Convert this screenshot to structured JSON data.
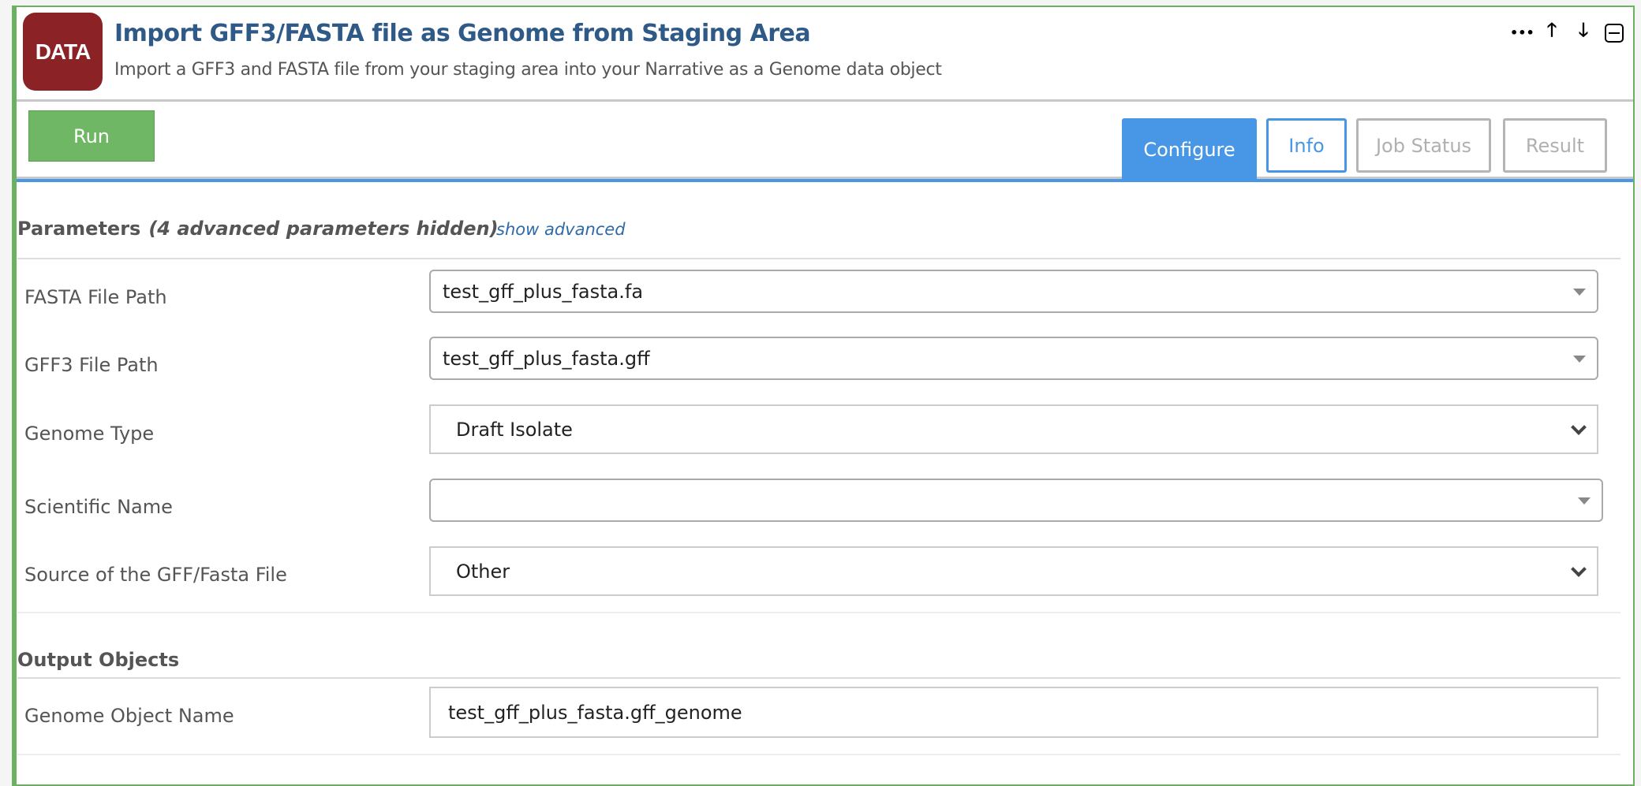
{
  "header": {
    "logo_text": "DATA",
    "title": "Import GFF3/FASTA file as Genome from Staging Area",
    "subtitle": "Import a GFF3 and FASTA file from your staging area into your Narrative as a Genome data object",
    "icons": [
      "more-icon",
      "arrow-up-icon",
      "arrow-down-icon",
      "collapse-icon"
    ],
    "more_glyph": "•••",
    "up_glyph": "🡑",
    "down_glyph": "🡓"
  },
  "toolbar": {
    "run_label": "Run",
    "tabs": [
      {
        "label": "Configure",
        "state": "active"
      },
      {
        "label": "Info",
        "state": "enabled"
      },
      {
        "label": "Job Status",
        "state": "disabled"
      },
      {
        "label": "Result",
        "state": "disabled"
      }
    ]
  },
  "parameters": {
    "heading": "Parameters",
    "hidden_note": "(4 advanced parameters hidden)",
    "show_advanced": "show advanced",
    "fields": [
      {
        "label": "FASTA File Path",
        "value": "test_gff_plus_fasta.fa"
      },
      {
        "label": "GFF3 File Path",
        "value": "test_gff_plus_fasta.gff"
      },
      {
        "label": "Genome Type",
        "value": "Draft Isolate"
      },
      {
        "label": "Scientific Name",
        "value": ""
      },
      {
        "label": "Source of the GFF/Fasta File",
        "value": "Other"
      }
    ]
  },
  "outputs": {
    "heading": "Output Objects",
    "fields": [
      {
        "label": "Genome Object Name",
        "value": "test_gff_plus_fasta.gff_genome"
      }
    ]
  },
  "colors": {
    "accent": "#4896e6",
    "run": "#6fb665",
    "logo": "#8b2326",
    "border": "#6ab25f"
  }
}
